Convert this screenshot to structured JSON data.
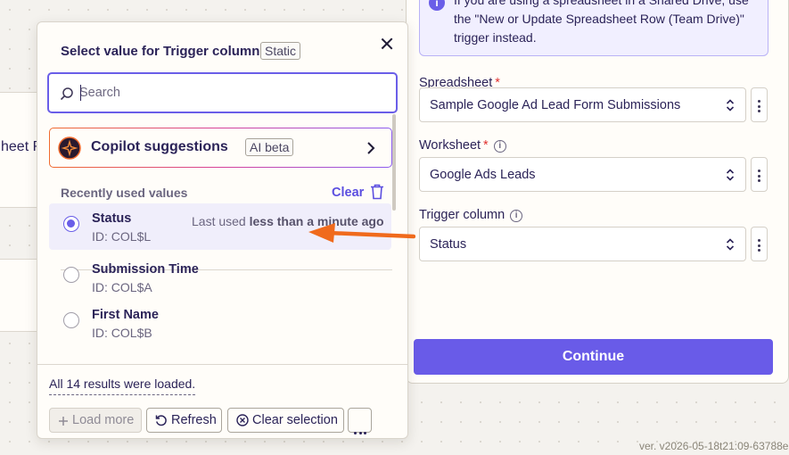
{
  "background": {
    "partial_node_label": "heet R"
  },
  "right_panel": {
    "info_text": "If you are using a spreadsheet in a Shared Drive, use the \"New or Update Spreadsheet Row (Team Drive)\" trigger instead.",
    "info_icon": "info-icon",
    "fields": [
      {
        "label": "Spreadsheet",
        "required": true,
        "help": false,
        "value": "Sample Google Ad Lead Form Submissions"
      },
      {
        "label": "Worksheet",
        "required": true,
        "help": true,
        "value": "Google Ads Leads"
      },
      {
        "label": "Trigger column",
        "required": false,
        "help": true,
        "value": "Status"
      }
    ],
    "continue_label": "Continue"
  },
  "modal": {
    "title": "Select value for Trigger column",
    "static_tag": "Static",
    "search": {
      "placeholder": "Search",
      "value": ""
    },
    "copilot": {
      "title": "Copilot suggestions",
      "tag": "AI beta"
    },
    "recent": {
      "label": "Recently used values",
      "clear_label": "Clear"
    },
    "options": [
      {
        "name": "Status",
        "id": "ID: COL$L",
        "selected": true,
        "last_used_prefix": "Last used",
        "last_used_value": "less than a minute ago"
      },
      {
        "name": "Submission Time",
        "id": "ID: COL$A",
        "selected": false
      },
      {
        "name": "First Name",
        "id": "ID: COL$B",
        "selected": false
      }
    ],
    "results_loaded": "All 14 results were loaded.",
    "buttons": {
      "load_more": "Load more",
      "refresh": "Refresh",
      "clear_selection": "Clear selection"
    }
  },
  "version": "ver. v2026-05-18t21:09-63788e9",
  "colors": {
    "accent": "#695be8",
    "required": "#e0312f",
    "annotation_arrow": "#f06a1c"
  }
}
